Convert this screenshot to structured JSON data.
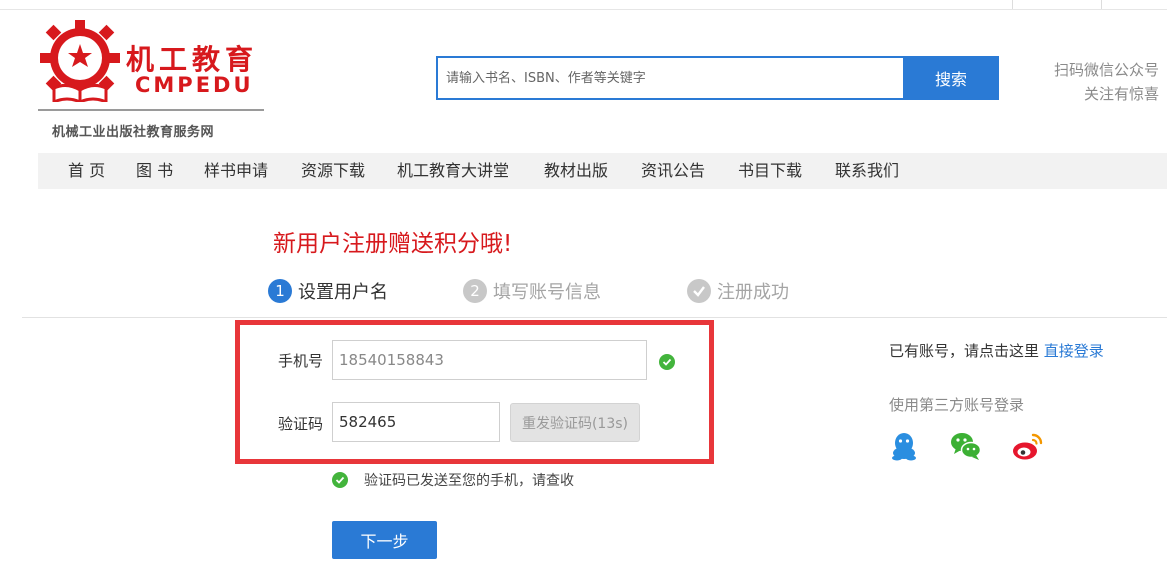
{
  "site": {
    "brand_cn": "机工教育",
    "brand_en": "CMPEDU",
    "tagline": "机械工业出版社教育服务网"
  },
  "search": {
    "placeholder": "请输入书名、ISBN、作者等关键字",
    "button_label": "搜索"
  },
  "wechat_promo": {
    "line1": "扫码微信公众号",
    "line2": "关注有惊喜"
  },
  "nav": {
    "items": [
      {
        "label": "首 页"
      },
      {
        "label": "图 书"
      },
      {
        "label": "样书申请"
      },
      {
        "label": "资源下载"
      },
      {
        "label": "机工教育大讲堂"
      },
      {
        "label": "教材出版"
      },
      {
        "label": "资讯公告"
      },
      {
        "label": "书目下载"
      },
      {
        "label": "联系我们"
      }
    ]
  },
  "register": {
    "promo": "新用户注册赠送积分哦!",
    "steps": [
      {
        "num": "1",
        "label": "设置用户名"
      },
      {
        "num": "2",
        "label": "填写账号信息"
      },
      {
        "num": "",
        "label": "注册成功"
      }
    ],
    "phone_label": "手机号",
    "phone_value": "18540158843",
    "code_label": "验证码",
    "code_value": "582465",
    "resend_label": "重发验证码(13s)",
    "sent_message": "验证码已发送至您的手机，请查收",
    "next_label": "下一步"
  },
  "side": {
    "have_account": "已有账号，请点击这里 ",
    "login_link": "直接登录",
    "third_party_title": "使用第三方账号登录"
  },
  "colors": {
    "accent": "#2a7ad5",
    "brand_red": "#d7191d",
    "success": "#43b43c",
    "highlight": "#e8363a"
  }
}
